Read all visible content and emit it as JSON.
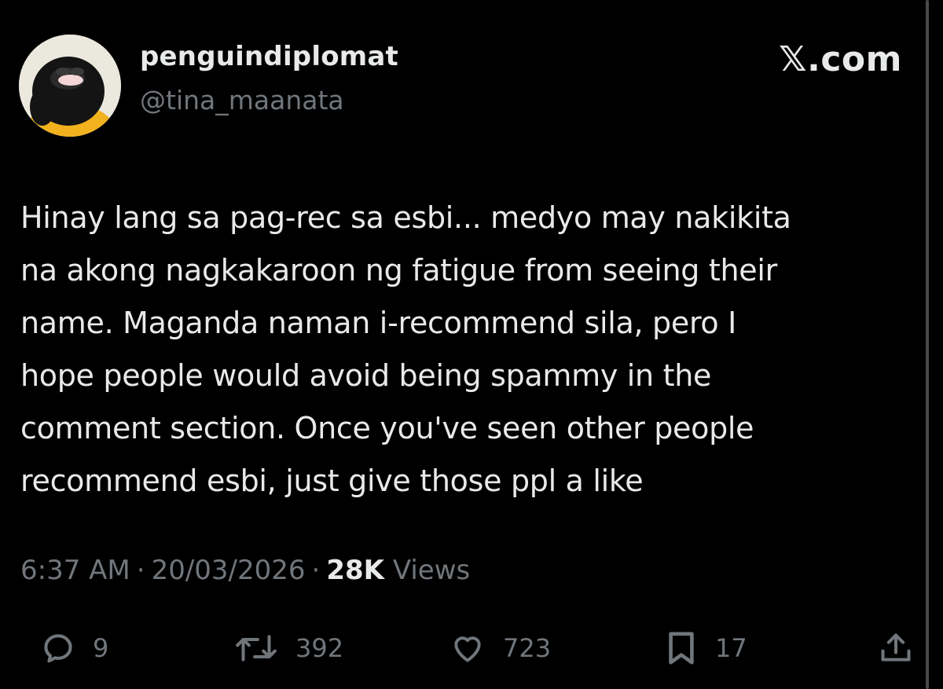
{
  "author": {
    "display_name": "penguindiplomat",
    "handle": "@tina_maanata"
  },
  "brand": {
    "label": "𝕏.com"
  },
  "tweet": {
    "lines": [
      "Hinay lang sa pag-rec sa esbi... medyo may nakikita",
      "na akong nagkakaroon ng fatigue from seeing their",
      "name. Maganda naman i-recommend sila, pero I",
      "hope people would avoid being spammy in the",
      "comment section. Once you've seen other people",
      "recommend esbi, just give those ppl a like"
    ]
  },
  "meta": {
    "time": "6:37 AM",
    "separator": "·",
    "date": "20/03/2026",
    "views_count": "28K",
    "views_label": "Views"
  },
  "actions": {
    "reply": {
      "icon": "reply-icon",
      "count": "9"
    },
    "repost": {
      "icon": "repost-icon",
      "count": "392"
    },
    "like": {
      "icon": "heart-icon",
      "count": "723"
    },
    "bookmark": {
      "icon": "bookmark-icon",
      "count": "17"
    },
    "share": {
      "icon": "share-icon"
    }
  },
  "colors": {
    "background": "#000000",
    "primary_text": "#e7e9ea",
    "secondary_text": "#71767b"
  }
}
